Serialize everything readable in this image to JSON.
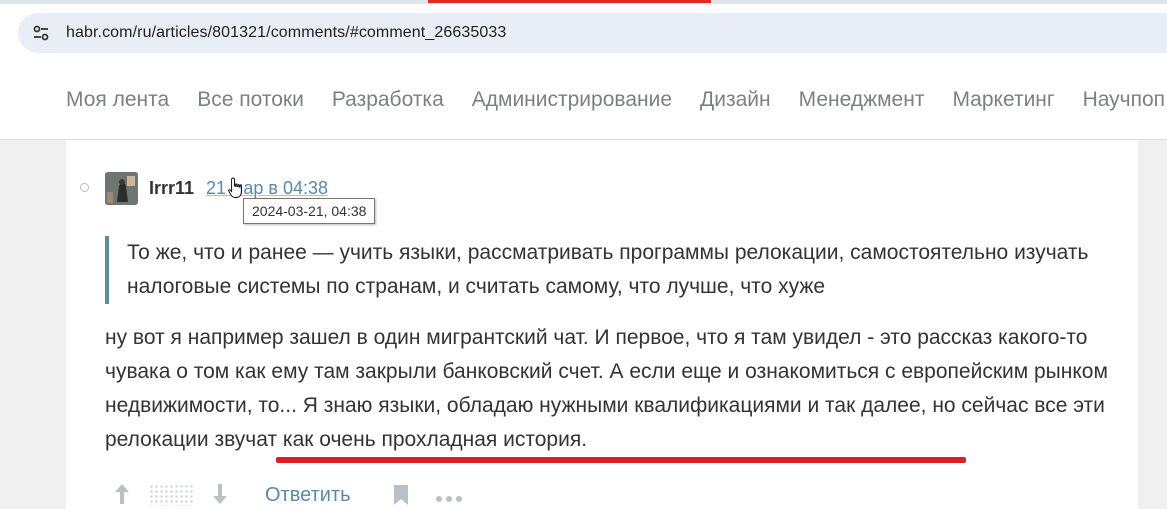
{
  "browser": {
    "url": "habr.com/ru/articles/801321/comments/#comment_26635033",
    "site_settings_icon": "tune-icon"
  },
  "nav": {
    "items": [
      "Моя лента",
      "Все потоки",
      "Разработка",
      "Администрирование",
      "Дизайн",
      "Менеджмент",
      "Маркетинг",
      "Научпоп"
    ]
  },
  "comment": {
    "author": "Irrr11",
    "time_text": "21 мар в 04:38",
    "tooltip": "2024-03-21, 04:38",
    "quote": "То же, что и ранее — учить языки, рассматривать программы релокации, самостоятельно изучать налоговые системы по странам, и считать самому, что лучше, что хуже",
    "body": "ну вот я например зашел в один мигрантский чат. И первое, что я там увидел - это рассказ какого-то чувака о том как ему там закрыли банковский счет. А если еще и ознакомиться с европейским рынком недвижимости, то... Я знаю языки, обладаю нужными квалификациями и так далее, но сейчас все эти релокации звучат как очень прохладная история.",
    "actions": {
      "reply_label": "Ответить"
    }
  },
  "colors": {
    "link": "#5a88a8",
    "quote_border": "#5d8aa5",
    "annotation_red": "#d9202a"
  }
}
